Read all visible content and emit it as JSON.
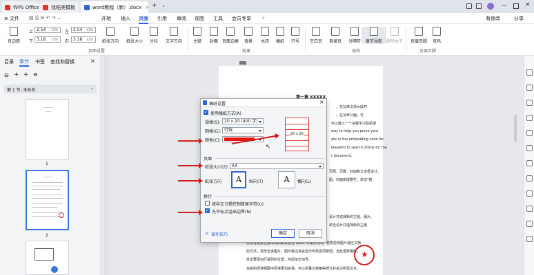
{
  "app": {
    "tabs": [
      {
        "label": "WPS Office"
      },
      {
        "label": "找稻壳模板"
      },
      {
        "label": "word教程（新）.docx"
      }
    ],
    "new_tab": "+"
  },
  "menu": {
    "file": "≡ 文件",
    "items": [
      "开始",
      "插入",
      "页面",
      "引用",
      "审阅",
      "视图",
      "工具",
      "会员专享"
    ],
    "active": "页面",
    "right": [
      "有修改",
      "分享"
    ]
  },
  "toolbar": {
    "margin_top_label": "上",
    "margin_top": "2.54",
    "margin_bottom_label": "下",
    "margin_bottom": "3.18",
    "margin_left_label": "左",
    "margin_left": "2.54",
    "margin_right_label": "右",
    "margin_right": "3.18",
    "unit": "cm",
    "buttons": [
      "页边距",
      "纸张方向",
      "纸张大小",
      "分栏",
      "文字方向",
      "主题",
      "封面",
      "页面边框",
      "背景",
      "水印",
      "稿纸",
      "行号",
      "空白页",
      "目录页",
      "分隔符",
      "章节导航",
      "删除本节",
      "页眉页脚",
      "页码"
    ],
    "groups": [
      "页面设置",
      "效果",
      "结构",
      "页眉页脚"
    ]
  },
  "sidebar": {
    "tabs": [
      "目录",
      "章节",
      "书签",
      "查找和替换"
    ],
    "active_tab": "章节",
    "section": "第 1 节: 未命名",
    "pages": [
      "1",
      "2"
    ]
  },
  "document": {
    "heading": "第一章  XXXXX",
    "snippets": [
      "，在功率占领大段时",
      "。在功率公面，可",
      "可以健入一个关键字以联机搜",
      "way to help you prove your",
      "ate in the embedding code for",
      "keyword to search online for the",
      "r document.",
      "页眉、页脚、封面和文本框设计。",
      "图、封面和提要栏。单击\"插",
      "设计并选择新的主题。图片、",
      "单击设计并选择新的主题",
      "使用在需要位置出现的新按钮在 Word 中保存时间。若要更改图片适应文档",
      "的方式，请单击该图片，图片旁边将会显示布局选项按钮。当处理表格时，",
      "单击要添加行或列的位置，然后单击加号。",
      "在新的阅读视图中阅读更加容易。可以折叠文档某些部分并关注所需文本。"
    ]
  },
  "dialog": {
    "title": "稿纸设置",
    "use_grid_label": "使用稿纸方式(A)",
    "use_grid_checked": true,
    "spec_label": "规格(S):",
    "spec_value": "20 x 20 (400 字)",
    "grid_label": "网格(G):",
    "grid_value": "行线",
    "color_label": "颜色(C):",
    "color_value": "#e8170d",
    "preview_text": "20 x 20",
    "page_section": "页面",
    "paper_size_label": "纸张大小(Z):",
    "paper_size_value": "A4",
    "orientation_label": "纸张方向",
    "portrait_label": "纵向(T)",
    "landscape_label": "横向(L)",
    "orientation_glyph": "A",
    "wrap_section": "换行",
    "option1_label": "按中文习惯控制首尾字符(U)",
    "option1_checked": false,
    "option2_label": "允许标点溢出边界(N)",
    "option2_checked": true,
    "tips_label": "操作技巧",
    "ok_label": "确定",
    "cancel_label": "取消"
  },
  "colors": {
    "accent": "#2f64d6",
    "arrow": "#d31b1b",
    "preview_grid": "#d93a3a"
  }
}
